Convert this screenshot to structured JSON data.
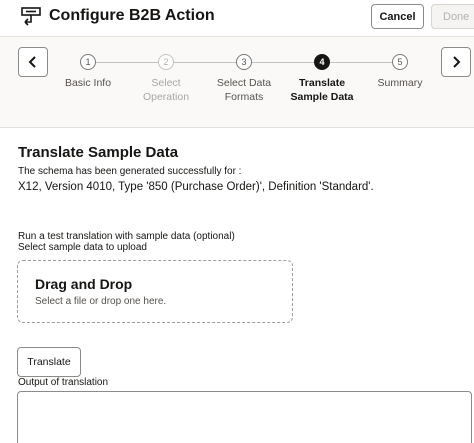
{
  "header": {
    "title": "Configure B2B Action",
    "icon": "b2b-action-icon",
    "cancel_label": "Cancel",
    "done_label": "Done"
  },
  "train": {
    "prev_icon": "chevron-left-icon",
    "next_icon": "chevron-right-icon",
    "steps": [
      {
        "number": "1",
        "label_line1": "Basic Info",
        "label_line2": "",
        "state": "completed"
      },
      {
        "number": "2",
        "label_line1": "Select",
        "label_line2": "Operation",
        "state": "disabled"
      },
      {
        "number": "3",
        "label_line1": "Select Data",
        "label_line2": "Formats",
        "state": "visited"
      },
      {
        "number": "4",
        "label_line1": "Translate",
        "label_line2": "Sample Data",
        "state": "active"
      },
      {
        "number": "5",
        "label_line1": "Summary",
        "label_line2": "",
        "state": "unvisited"
      }
    ]
  },
  "main": {
    "section_title": "Translate Sample Data",
    "schema_message": "The schema has been generated successfully for :",
    "schema_detail": "X12, Version 4010, Type '850 (Purchase Order)', Definition 'Standard'.",
    "run_label": "Run a test translation with sample data (optional)",
    "upload_label": "Select sample data to upload",
    "dropzone_title": "Drag and Drop",
    "dropzone_subtitle": "Select a file or drop one here.",
    "translate_label": "Translate",
    "output_label": "Output of translation",
    "output_value": ""
  },
  "colors": {
    "text": "#161513",
    "train_background": "#fbf9f8",
    "active_step": "#161513",
    "border": "#8d8b88"
  }
}
